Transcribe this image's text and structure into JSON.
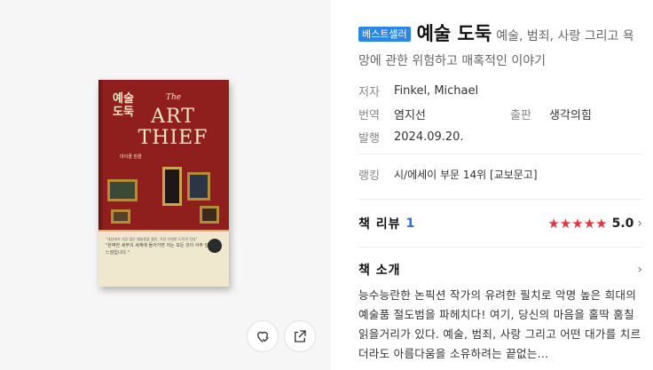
{
  "cover": {
    "ko_title": "예술\n도둑",
    "en_the": "The",
    "en_title": "ART\nTHIEF",
    "author_line": "마이클 핀클",
    "band_lines": [
      "\"세상에서 가장 많은 예술품을 훔친, 가장 유명한 도둑의 진실\"",
      "\"완벽한 세부의 세계에 들어가면 저는 모든 것이 아주 달라진 느낌입니다.\""
    ]
  },
  "actions": {
    "wish_icon": "heart-check-icon",
    "share_icon": "share-icon"
  },
  "book": {
    "badge": "베스트셀러",
    "title": "예술 도둑",
    "subtitle": "예술, 범죄, 사랑 그리고 욕망에 관한 위험하고 매혹적인 이야기",
    "author_label": "저자",
    "author": "Finkel, Michael",
    "translator_label": "번역",
    "translator": "염지선",
    "publisher_label": "출판",
    "publisher": "생각의힘",
    "date_label": "발행",
    "date": "2024.09.20."
  },
  "ranking": {
    "label": "랭킹",
    "value": "시/에세이 부문 14위 [교보문고]"
  },
  "review": {
    "title": "책 리뷰",
    "count": "1",
    "rating": 5.0,
    "rating_text": "5.0",
    "chevron": "›"
  },
  "intro": {
    "title": "책 소개",
    "chevron": "›",
    "text": "능수능란한 논픽션 작가의 유려한 필치로 악명 높은 희대의 예술품 절도범을 파헤치다! 여기, 당신의 마음을 홀딱 훔칠 읽을거리가 있다. 예술, 범죄, 사랑 그리고 어떤 대가를 치르더라도 아름다움을 소유하려는 끝없는…"
  },
  "colors": {
    "badge": "#2b87e3",
    "star": "#e8343f",
    "review_count": "#2b6fe0",
    "cover_red": "#8f1f1c"
  }
}
